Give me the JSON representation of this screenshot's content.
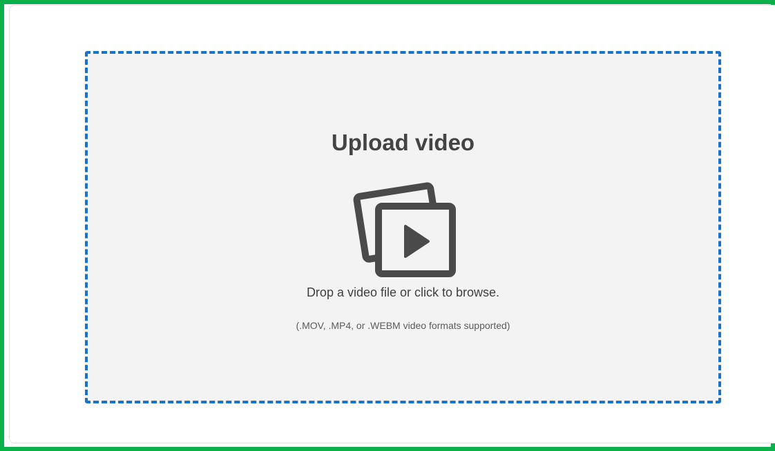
{
  "upload": {
    "title": "Upload video",
    "hint": "Drop a video file or click to browse.",
    "formats": "(.MOV, .MP4, or .WEBM video formats supported)"
  },
  "icons": {
    "upload_icon": "video-files-icon"
  },
  "colors": {
    "frame_border": "#0ab04a",
    "dropzone_border": "#1a73c8",
    "dropzone_background": "#f3f3f3",
    "icon": "#4a4a4a"
  }
}
